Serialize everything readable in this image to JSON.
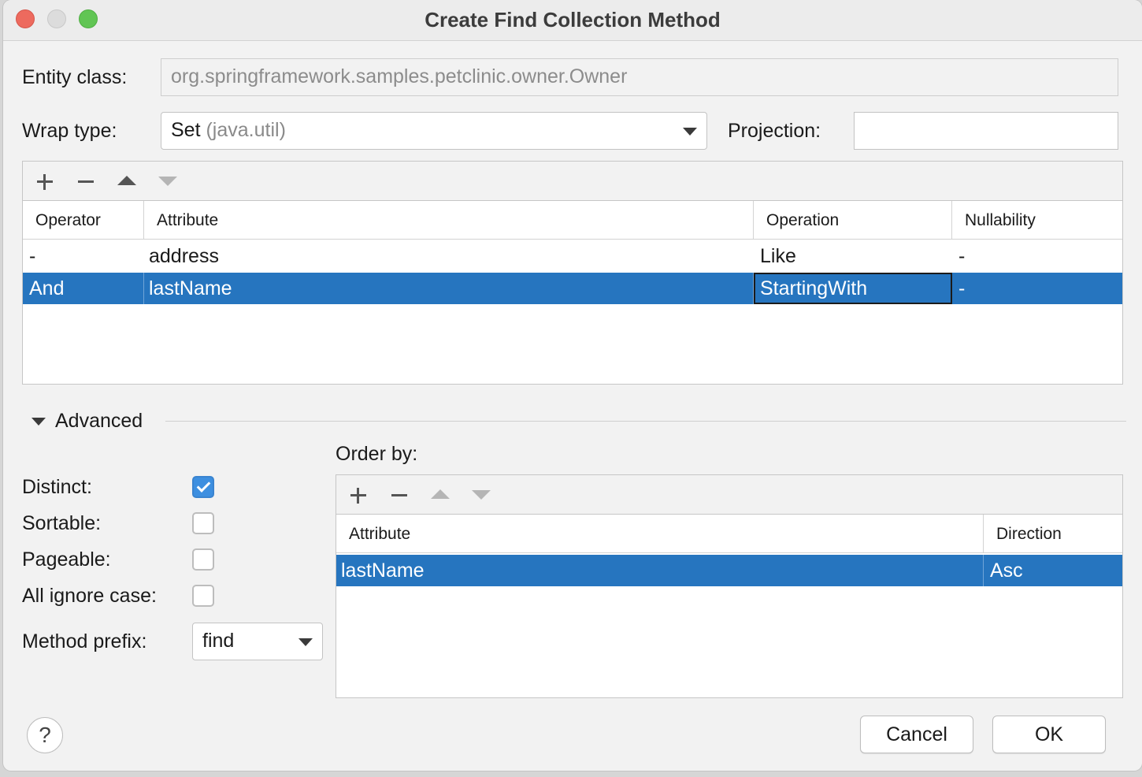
{
  "window": {
    "title": "Create Find Collection Method"
  },
  "entity_class": {
    "label": "Entity class:",
    "value": "org.springframework.samples.petclinic.owner.Owner"
  },
  "wrap_type": {
    "label": "Wrap type:",
    "value": "Set",
    "package": "(java.util)"
  },
  "projection": {
    "label": "Projection:",
    "value": ""
  },
  "conditions_table": {
    "columns": [
      "Operator",
      "Attribute",
      "Operation",
      "Nullability"
    ],
    "rows": [
      {
        "operator": "-",
        "attribute": "address",
        "operation": "Like",
        "nullability": "-"
      },
      {
        "operator": "And",
        "attribute": "lastName",
        "operation": "StartingWith",
        "nullability": "-"
      }
    ]
  },
  "advanced": {
    "label": "Advanced",
    "distinct": {
      "label": "Distinct:",
      "checked": true
    },
    "sortable": {
      "label": "Sortable:",
      "checked": false
    },
    "pageable": {
      "label": "Pageable:",
      "checked": false
    },
    "all_ignore_case": {
      "label": "All ignore case:",
      "checked": false
    },
    "method_prefix": {
      "label": "Method prefix:",
      "value": "find"
    }
  },
  "order_by": {
    "label": "Order by:",
    "columns": [
      "Attribute",
      "Direction"
    ],
    "rows": [
      {
        "attribute": "lastName",
        "direction": "Asc"
      }
    ]
  },
  "footer": {
    "help": "?",
    "cancel": "Cancel",
    "ok": "OK"
  },
  "colors": {
    "selection": "#2675bf",
    "checkbox_checked": "#3d8fe0"
  }
}
